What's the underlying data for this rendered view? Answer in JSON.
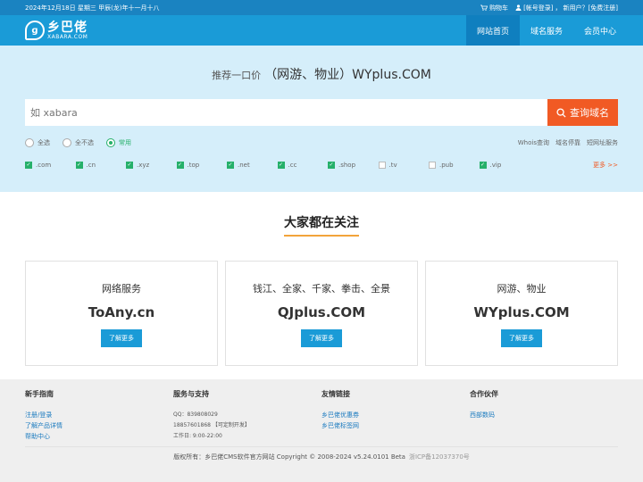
{
  "topbar": {
    "date": "2024年12月18日 星期三 甲辰(龙)年十一月十八",
    "cart": "购物车",
    "login": "[帐号登录]",
    "new_user": "新用户？[免费注册]"
  },
  "header": {
    "logo_cn": "乡巴佬",
    "logo_en": "XABARA.COM",
    "nav": [
      "网站首页",
      "域名服务",
      "会员中心"
    ]
  },
  "hero": {
    "headline_prefix": "推荐一口价",
    "headline_main": "（网游、物业）WYplus.COM",
    "search_placeholder": "如 xabara",
    "search_button": "查询域名",
    "radios": [
      "全选",
      "全不选",
      "常用"
    ],
    "radio_selected": "常用",
    "links": [
      "Whois查询",
      "域名停靠",
      "短网址服务"
    ],
    "tlds": [
      {
        "label": ".com",
        "checked": true
      },
      {
        "label": ".cn",
        "checked": true
      },
      {
        "label": ".xyz",
        "checked": true
      },
      {
        "label": ".top",
        "checked": true
      },
      {
        "label": ".net",
        "checked": true
      },
      {
        "label": ".cc",
        "checked": true
      },
      {
        "label": ".shop",
        "checked": true
      },
      {
        "label": ".tv",
        "checked": false
      },
      {
        "label": ".pub",
        "checked": false
      },
      {
        "label": ".vip",
        "checked": true
      }
    ],
    "more": "更多 >>"
  },
  "focus": {
    "title": "大家都在关注",
    "cards": [
      {
        "title": "网络服务",
        "domain": "ToAny.cn",
        "button": "了解更多"
      },
      {
        "title": "钱江、全家、千家、拳击、全景",
        "domain": "QJplus.COM",
        "button": "了解更多"
      },
      {
        "title": "网游、物业",
        "domain": "WYplus.COM",
        "button": "了解更多"
      }
    ]
  },
  "footer": {
    "col1": {
      "title": "新手指南",
      "links": [
        "注册/登录",
        "了解产品详情",
        "帮助中心"
      ]
    },
    "col2": {
      "title": "服务与支持",
      "lines": [
        "QQ：839808029",
        "18857601868 【可定制开发】",
        "工作日: 9:00-22:00"
      ]
    },
    "col3": {
      "title": "友情链接",
      "links": [
        "乡巴佬优惠券",
        "乡巴佬标签网"
      ]
    },
    "col4": {
      "title": "合作伙伴",
      "links": [
        "西部数码"
      ]
    },
    "copyright": "版权所有：乡巴佬CMS软件官方网站 Copyright © 2008-2024 v5.24.0101 Beta",
    "icp": "浙ICP备12037370号"
  },
  "colors": {
    "primary": "#1a9bd7",
    "accent": "#f15a24",
    "check": "#26b06a",
    "hero_bg": "#d5eefa"
  }
}
